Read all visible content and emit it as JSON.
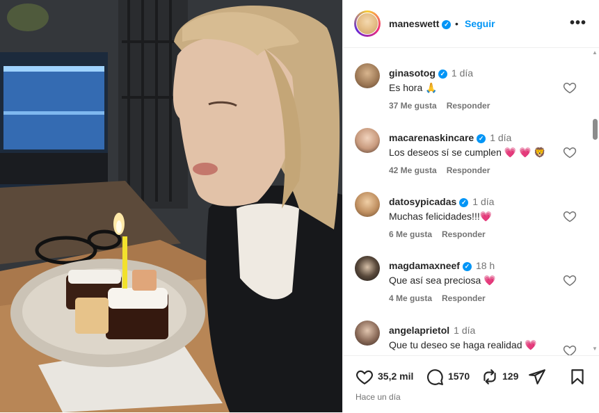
{
  "post": {
    "username": "maneswett",
    "follow_label": "Seguir",
    "separator": "•",
    "more_label": "•••"
  },
  "comments": [
    {
      "username": "ginasotog",
      "time": "1 día",
      "text": "Es hora 🙏",
      "likes": "37 Me gusta",
      "reply": "Responder",
      "verified": true
    },
    {
      "username": "macarenaskincare",
      "time": "1 día",
      "text": "Los deseos sí se cumplen 💗 💗 🦁",
      "likes": "42 Me gusta",
      "reply": "Responder",
      "verified": true
    },
    {
      "username": "datosypicadas",
      "time": "1 día",
      "text": "Muchas felicidades!!!💗",
      "likes": "6 Me gusta",
      "reply": "Responder",
      "verified": true
    },
    {
      "username": "magdamaxneef",
      "time": "18 h",
      "text": "Que así sea preciosa 💗",
      "likes": "4 Me gusta",
      "reply": "Responder",
      "verified": true
    },
    {
      "username": "angelaprietol",
      "time": "1 día",
      "text": "Que tu deseo se haga realidad 💗",
      "likes": "",
      "reply": "",
      "verified": false
    }
  ],
  "actions": {
    "likes": "35,2 mil",
    "comments": "1570",
    "reposts": "129",
    "posted": "Hace un día"
  },
  "colors": {
    "accent": "#0095f6",
    "text": "#262626",
    "muted": "#737373"
  }
}
